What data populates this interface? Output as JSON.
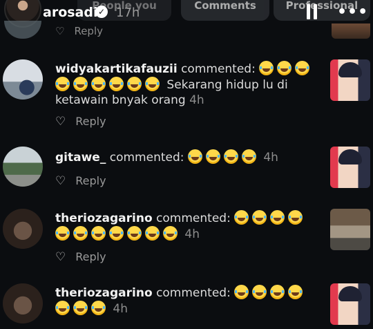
{
  "header": {
    "author": "arosadi",
    "time": "17h",
    "chips": [
      "People you follow",
      "Comments",
      "Professional"
    ]
  },
  "top_partial": {
    "reply_label": "Reply"
  },
  "comments": [
    {
      "username": "widyakartikafauzii",
      "verb": "commented:",
      "line1_emojis": 3,
      "line2_emojis": 6,
      "text": "Sekarang hidup lu di ketawain bnyak orang",
      "time": "4h",
      "reply_label": "Reply"
    },
    {
      "username": "gitawe_",
      "verb": "commented:",
      "emojis": 4,
      "time": "4h",
      "reply_label": "Reply"
    },
    {
      "username": "theriozagarino",
      "verb": "commented:",
      "line1_emojis": 4,
      "line2_emojis": 7,
      "time": "4h",
      "reply_label": "Reply"
    },
    {
      "username": "theriozagarino",
      "verb": "commented:",
      "line1_emojis": 4,
      "line2_emojis": 3,
      "time": "4h",
      "reply_label": "Reply"
    }
  ],
  "icons": {
    "emoji": "face-with-tears-of-joy-icon",
    "like": "heart-outline-icon",
    "verified": "verified-badge-icon",
    "pause": "pause-icon",
    "more": "more-icon"
  },
  "colors": {
    "background": "#0b0d10",
    "text": "#dcdcdc",
    "muted": "#8d8d8d"
  }
}
